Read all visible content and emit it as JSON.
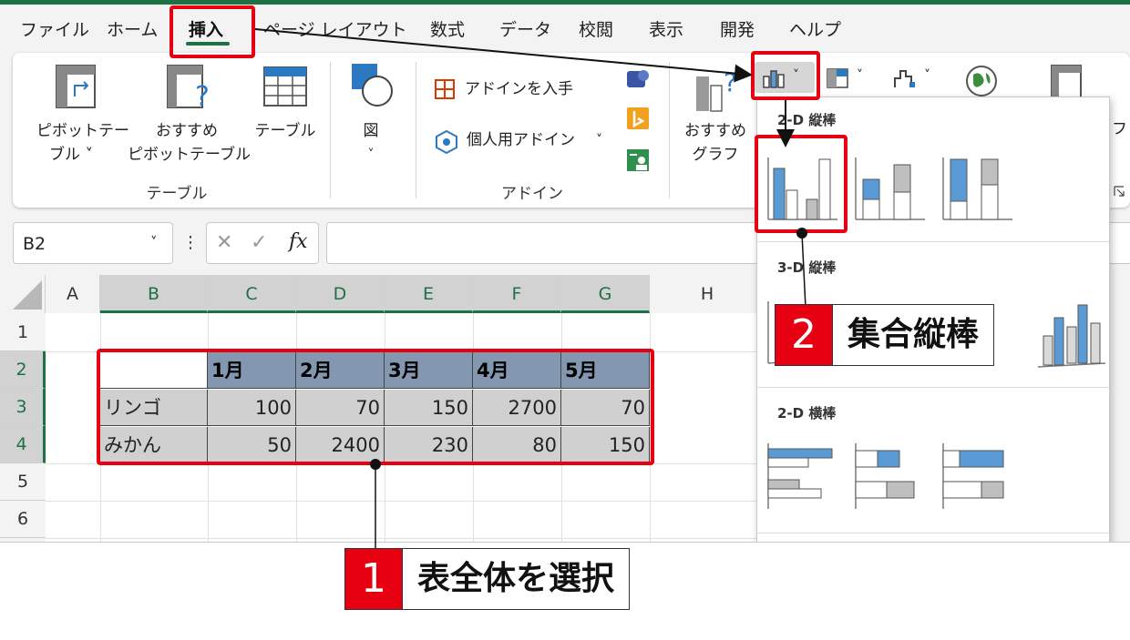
{
  "menu": {
    "tabs": [
      {
        "label": "ファイル"
      },
      {
        "label": "ホーム"
      },
      {
        "label": "挿入"
      },
      {
        "label": "ページ レイアウト"
      },
      {
        "label": "数式"
      },
      {
        "label": "データ"
      },
      {
        "label": "校閲"
      },
      {
        "label": "表示"
      },
      {
        "label": "開発"
      },
      {
        "label": "ヘルプ"
      }
    ],
    "active": "挿入"
  },
  "ribbon": {
    "pivot_table_line1": "ピボットテー",
    "pivot_table_line2": "ブル ˅",
    "recommended_pivot_line1": "おすすめ",
    "recommended_pivot_line2": "ピボットテーブル",
    "table": "テーブル",
    "group_tables": "テーブル",
    "illustrations": "図",
    "illustrations_arrow": "˅",
    "get_addins": "アドインを入手",
    "my_addins": "個人用アドイン",
    "my_addins_arrow": "˅",
    "group_addins": "アドイン",
    "recommended_charts_line1": "おすすめ",
    "recommended_charts_line2": "グラフ",
    "partial_label": "フ"
  },
  "formula_bar": {
    "name_box": "B2",
    "name_box_arrow": "˅",
    "more": "⋮",
    "cancel": "✕",
    "enter": "✓",
    "fx": "fx",
    "formula": ""
  },
  "grid": {
    "columns": [
      "A",
      "B",
      "C",
      "D",
      "E",
      "F",
      "G",
      "H"
    ],
    "rows": [
      "1",
      "2",
      "3",
      "4",
      "5",
      "6"
    ],
    "table": {
      "headers": [
        "",
        "1月",
        "2月",
        "3月",
        "4月",
        "5月"
      ],
      "rows": [
        {
          "label": "リンゴ",
          "values": [
            "100",
            "70",
            "150",
            "2700",
            "70"
          ]
        },
        {
          "label": "みかん",
          "values": [
            "50",
            "2400",
            "230",
            "80",
            "150"
          ]
        }
      ]
    }
  },
  "chart_dropdown": {
    "section_2d_column": "2-D 縦棒",
    "section_3d_column": "3-D 縦棒",
    "section_2d_bar": "2-D 横棒",
    "insert_column_arrow": "˅"
  },
  "annotations": {
    "step1_number": "1",
    "step1_text": "表全体を選択",
    "step2_number": "2",
    "step2_text": "集合縦棒"
  },
  "colors": {
    "excel_green": "#1e7145",
    "header_fill": "#8497b0",
    "cell_fill": "#d0d0d0",
    "annotation_red": "#e60012",
    "chart_blue": "#5b9bd5",
    "chart_gray": "#bfbfbf"
  }
}
